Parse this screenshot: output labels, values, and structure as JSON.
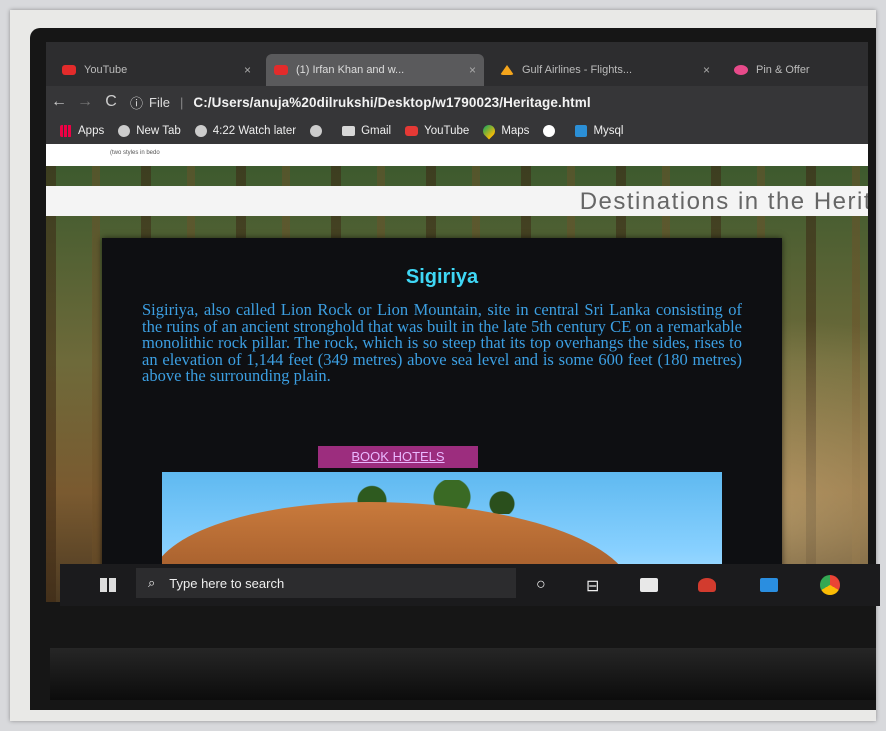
{
  "tabs": [
    {
      "label": "YouTube",
      "close": "×",
      "icon": "youtube-icon"
    },
    {
      "label": "(1) Irfan Khan and w...",
      "close": "×",
      "icon": "youtube-icon"
    },
    {
      "label": "Gulf Airlines - Flights...",
      "close": "×",
      "icon": "flight-icon"
    },
    {
      "label": "Pin & Offer",
      "close": "",
      "icon": "pin-icon"
    }
  ],
  "navbar": {
    "back": "←",
    "forward": "→",
    "reload": "C",
    "info": "ⓘ",
    "file_label": "File",
    "separator": "|",
    "url": "C:/Users/anuja%20dilrukshi/Desktop/w1790023/Heritage.html"
  },
  "bookmarks": [
    {
      "label": "Apps"
    },
    {
      "label": "New Tab"
    },
    {
      "label": "4:22 Watch later"
    },
    {
      "label": ""
    },
    {
      "label": "Gmail"
    },
    {
      "label": "YouTube"
    },
    {
      "label": "Maps"
    },
    {
      "label": ""
    },
    {
      "label": "Mysql"
    }
  ],
  "page": {
    "top_strip_text": "(two styles in bedo",
    "heading": "Destinations in the Herit",
    "card": {
      "title": "Sigiriya",
      "text": "Sigiriya, also called Lion Rock or Lion Mountain, site in central Sri Lanka consisting of the ruins of an ancient stronghold that was built in the late 5th century CE on a remarkable monolithic rock pillar. The rock, which is so steep that its top overhangs the sides, rises to an elevation of 1,144 feet (349 metres) above sea level and is some 600 feet (180 metres) above the surrounding plain.",
      "button": "BOOK HOTELS"
    }
  },
  "taskbar": {
    "search_placeholder": "Type here to search",
    "search_icon_glyph": "⌕",
    "cortana_glyph": "○",
    "taskview_glyph": "⊟"
  }
}
